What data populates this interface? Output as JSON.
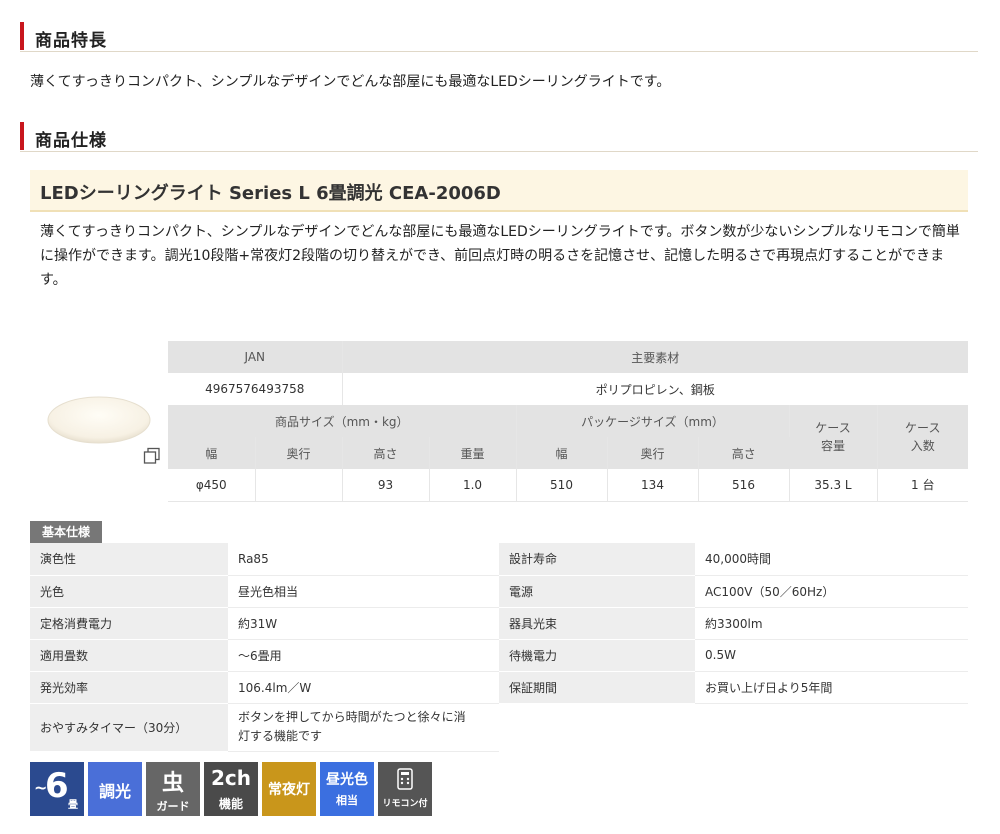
{
  "features": {
    "heading": "商品特長",
    "text": "薄くてすっきりコンパクト、シンプルなデザインでどんな部屋にも最適なLEDシーリングライトです。"
  },
  "specs": {
    "heading": "商品仕様",
    "product_title": "LEDシーリングライト Series L 6畳調光  CEA-2006D",
    "description": "薄くてすっきりコンパクト、シンプルなデザインでどんな部屋にも最適なLEDシーリングライトです。ボタン数が少ないシンプルなリモコンで簡単に操作ができます。調光10段階+常夜灯2段階の切り替えができ、前回点灯時の明るさを記憶させ、記憶した明るさで再現点灯することができます。"
  },
  "spec_table": {
    "jan_label": "JAN",
    "material_label": "主要素材",
    "jan_value": "4967576493758",
    "material_value": "ポリプロピレン、鋼板",
    "product_size_label": "商品サイズ（mm・kg）",
    "package_size_label": "パッケージサイズ（mm）",
    "case_volume_label_1": "ケース",
    "case_volume_label_2": "容量",
    "case_count_label_1": "ケース",
    "case_count_label_2": "入数",
    "sub_headers": [
      "幅",
      "奥行",
      "高さ",
      "重量",
      "幅",
      "奥行",
      "高さ"
    ],
    "values": [
      "φ450",
      "",
      "93",
      "1.0",
      "510",
      "134",
      "516",
      "35.3 L",
      "1 台"
    ]
  },
  "basic": {
    "tag": "基本仕様",
    "rows": [
      {
        "k1": "演色性",
        "v1": "Ra85",
        "k2": "設計寿命",
        "v2": "40,000時間"
      },
      {
        "k1": "光色",
        "v1": "昼光色相当",
        "k2": "電源",
        "v2": "AC100V（50／60Hz）"
      },
      {
        "k1": "定格消費電力",
        "v1": "約31W",
        "k2": "器具光束",
        "v2": "約3300lm"
      },
      {
        "k1": "適用畳数",
        "v1": "～6畳用",
        "k2": "待機電力",
        "v2": "0.5W"
      },
      {
        "k1": "発光効率",
        "v1": "106.4lm／W",
        "k2": "保証期間",
        "v2": "お買い上げ日より5年間"
      }
    ],
    "timer_label": "おやすみタイマー（30分）",
    "timer_value_1": "ボタンを押してから時間がたつと徐々に消",
    "timer_value_2": "灯する機能です"
  },
  "badges": {
    "tatami_prefix": "~",
    "tatami_num": "6",
    "tatami_unit": "畳",
    "dimming": "調光",
    "bug_main": "虫",
    "bug_sub": "ガード",
    "ch_main": "2ch",
    "ch_sub": "機能",
    "nightlight": "常夜灯",
    "daylight_main": "昼光色",
    "daylight_sub": "相当",
    "remote_sub": "リモコン付",
    "colors": {
      "tatami": "#2b4a8f",
      "dimming": "#4a6fd8",
      "bug": "#666666",
      "ch": "#4a4a4a",
      "nightlight": "#c9961b",
      "daylight": "#3b6fe0",
      "remote": "#555555"
    }
  }
}
